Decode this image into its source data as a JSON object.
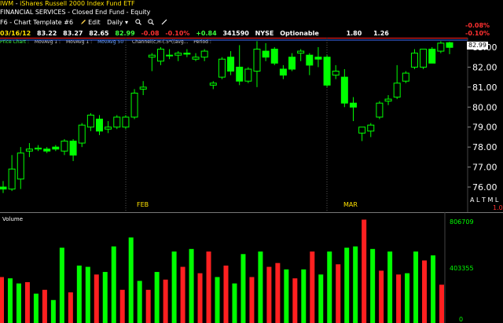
{
  "header": {
    "symbol": "IWM",
    "description": "iShares Russell 2000 Index Fund ETF",
    "subtitle": "FINANCIAL SERVICES - Closed End Fund - Equity",
    "template": "F6 - Chart Template #6",
    "edit": "Edit",
    "interval": "Daily"
  },
  "quote": {
    "date": "03/16/12",
    "open": "83.22",
    "high": "83.27",
    "low": "82.65",
    "close": "82.99",
    "change": "-0.08",
    "pct": "-0.10%",
    "chg2": "+0.84",
    "volume": "341590",
    "exchange": "NYSE",
    "optionable": "Optionable",
    "v1": "1.80",
    "v2": "1.26",
    "right_top": "-0.08%",
    "right_bottom": "-0.10%"
  },
  "studies": {
    "price_chart": "Price Chart :",
    "ma1": "MovAvg 1 :",
    "ma2": "MovAvg 1 :",
    "ma3": "MovAvg 50 :",
    "channel": "Channel(c,H-(.5*((avg...",
    "period": "Period :"
  },
  "price_axis": [
    "83.00",
    "82.00",
    "81.00",
    "80.00",
    "79.00",
    "78.00",
    "77.00",
    "76.00"
  ],
  "close_tag": "82.99",
  "altml": "A L T M L",
  "scale_factor": "1.0",
  "months": [
    "FEB",
    "MAR"
  ],
  "volume_label": "Volume",
  "volume_axis": [
    "806709",
    "403355",
    "0"
  ],
  "colors": {
    "up": "#00ff00",
    "down": "#ff2020",
    "background": "#000000"
  },
  "chart_data": {
    "type": "candlestick+bar",
    "price_ylim": [
      75.5,
      83.5
    ],
    "volume_ylim": [
      0,
      806709
    ],
    "candles": [
      {
        "o": 76.0,
        "h": 76.3,
        "l": 75.7,
        "c": 75.9
      },
      {
        "o": 75.9,
        "h": 77.6,
        "l": 75.8,
        "c": 76.9
      },
      {
        "o": 76.4,
        "h": 78.0,
        "l": 75.9,
        "c": 77.7
      },
      {
        "o": 77.8,
        "h": 78.2,
        "l": 77.5,
        "c": 77.9
      },
      {
        "o": 77.9,
        "h": 78.1,
        "l": 77.8,
        "c": 77.95
      },
      {
        "o": 77.9,
        "h": 78.0,
        "l": 77.7,
        "c": 77.8
      },
      {
        "o": 78.0,
        "h": 78.1,
        "l": 77.8,
        "c": 77.9
      },
      {
        "o": 77.8,
        "h": 78.4,
        "l": 77.6,
        "c": 78.3
      },
      {
        "o": 78.3,
        "h": 78.4,
        "l": 77.3,
        "c": 77.6
      },
      {
        "o": 78.2,
        "h": 79.2,
        "l": 78.0,
        "c": 79.1
      },
      {
        "o": 79.0,
        "h": 79.7,
        "l": 78.8,
        "c": 79.6
      },
      {
        "o": 79.4,
        "h": 79.6,
        "l": 78.6,
        "c": 78.8
      },
      {
        "o": 78.9,
        "h": 79.3,
        "l": 78.7,
        "c": 79.0
      },
      {
        "o": 79.0,
        "h": 79.6,
        "l": 78.9,
        "c": 79.5
      },
      {
        "o": 79.0,
        "h": 79.6,
        "l": 78.9,
        "c": 79.5
      },
      {
        "o": 79.5,
        "h": 80.9,
        "l": 79.4,
        "c": 80.7
      },
      {
        "o": 80.9,
        "h": 81.3,
        "l": 80.6,
        "c": 81.0
      },
      {
        "o": 82.5,
        "h": 82.7,
        "l": 81.8,
        "c": 82.6
      },
      {
        "o": 82.3,
        "h": 83.0,
        "l": 82.1,
        "c": 82.9
      },
      {
        "o": 82.6,
        "h": 82.9,
        "l": 82.4,
        "c": 82.6
      },
      {
        "o": 82.6,
        "h": 82.8,
        "l": 82.3,
        "c": 82.7
      },
      {
        "o": 82.7,
        "h": 82.9,
        "l": 82.5,
        "c": 82.65
      },
      {
        "o": 82.4,
        "h": 82.7,
        "l": 82.3,
        "c": 82.5
      },
      {
        "o": 82.5,
        "h": 82.9,
        "l": 82.3,
        "c": 82.8
      },
      {
        "o": 81.1,
        "h": 81.3,
        "l": 80.9,
        "c": 81.2
      },
      {
        "o": 81.5,
        "h": 82.5,
        "l": 81.4,
        "c": 82.4
      },
      {
        "o": 82.5,
        "h": 82.8,
        "l": 81.6,
        "c": 81.8
      },
      {
        "o": 82.0,
        "h": 83.1,
        "l": 81.1,
        "c": 81.3
      },
      {
        "o": 81.3,
        "h": 82.0,
        "l": 81.2,
        "c": 81.9
      },
      {
        "o": 81.8,
        "h": 83.3,
        "l": 81.0,
        "c": 82.9
      },
      {
        "o": 82.8,
        "h": 83.2,
        "l": 82.3,
        "c": 82.5
      },
      {
        "o": 82.9,
        "h": 83.0,
        "l": 82.1,
        "c": 82.2
      },
      {
        "o": 81.9,
        "h": 82.1,
        "l": 81.4,
        "c": 81.6
      },
      {
        "o": 82.5,
        "h": 82.7,
        "l": 81.8,
        "c": 81.9
      },
      {
        "o": 82.7,
        "h": 82.9,
        "l": 82.3,
        "c": 82.8
      },
      {
        "o": 82.6,
        "h": 82.7,
        "l": 81.6,
        "c": 82.1
      },
      {
        "o": 82.5,
        "h": 83.0,
        "l": 82.0,
        "c": 82.4
      },
      {
        "o": 82.5,
        "h": 82.6,
        "l": 81.0,
        "c": 81.1
      },
      {
        "o": 81.6,
        "h": 82.1,
        "l": 81.4,
        "c": 81.8
      },
      {
        "o": 81.5,
        "h": 81.9,
        "l": 80.0,
        "c": 80.2
      },
      {
        "o": 80.2,
        "h": 80.5,
        "l": 79.3,
        "c": 80.0
      },
      {
        "o": 78.7,
        "h": 79.0,
        "l": 78.3,
        "c": 79.0
      },
      {
        "o": 78.8,
        "h": 79.2,
        "l": 78.5,
        "c": 79.1
      },
      {
        "o": 79.5,
        "h": 80.3,
        "l": 79.4,
        "c": 80.2
      },
      {
        "o": 80.3,
        "h": 80.6,
        "l": 80.1,
        "c": 80.4
      },
      {
        "o": 80.5,
        "h": 82.1,
        "l": 80.4,
        "c": 81.2
      },
      {
        "o": 81.3,
        "h": 81.8,
        "l": 81.2,
        "c": 81.7
      },
      {
        "o": 82.0,
        "h": 82.9,
        "l": 81.9,
        "c": 82.7
      },
      {
        "o": 82.0,
        "h": 82.9,
        "l": 81.9,
        "c": 82.9
      },
      {
        "o": 82.9,
        "h": 83.0,
        "l": 82.6,
        "c": 82.2
      },
      {
        "o": 82.8,
        "h": 83.3,
        "l": 82.7,
        "c": 83.2
      },
      {
        "o": 83.22,
        "h": 83.27,
        "l": 82.65,
        "c": 82.99
      }
    ],
    "volumes": [
      {
        "v": 360000,
        "up": false
      },
      {
        "v": 350000,
        "up": true
      },
      {
        "v": 310000,
        "up": true
      },
      {
        "v": 320000,
        "up": false
      },
      {
        "v": 230000,
        "up": true
      },
      {
        "v": 260000,
        "up": false
      },
      {
        "v": 180000,
        "up": true
      },
      {
        "v": 590000,
        "up": true
      },
      {
        "v": 240000,
        "up": false
      },
      {
        "v": 450000,
        "up": true
      },
      {
        "v": 440000,
        "up": true
      },
      {
        "v": 380000,
        "up": false
      },
      {
        "v": 400000,
        "up": true
      },
      {
        "v": 600000,
        "up": true
      },
      {
        "v": 260000,
        "up": false
      },
      {
        "v": 670000,
        "up": true
      },
      {
        "v": 330000,
        "up": true
      },
      {
        "v": 260000,
        "up": false
      },
      {
        "v": 400000,
        "up": true
      },
      {
        "v": 340000,
        "up": false
      },
      {
        "v": 560000,
        "up": true
      },
      {
        "v": 440000,
        "up": false
      },
      {
        "v": 580000,
        "up": true
      },
      {
        "v": 390000,
        "up": false
      },
      {
        "v": 560000,
        "up": false
      },
      {
        "v": 360000,
        "up": true
      },
      {
        "v": 450000,
        "up": false
      },
      {
        "v": 310000,
        "up": true
      },
      {
        "v": 540000,
        "up": true
      },
      {
        "v": 360000,
        "up": false
      },
      {
        "v": 560000,
        "up": true
      },
      {
        "v": 440000,
        "up": false
      },
      {
        "v": 470000,
        "up": false
      },
      {
        "v": 420000,
        "up": true
      },
      {
        "v": 350000,
        "up": false
      },
      {
        "v": 420000,
        "up": true
      },
      {
        "v": 560000,
        "up": false
      },
      {
        "v": 380000,
        "up": true
      },
      {
        "v": 560000,
        "up": true
      },
      {
        "v": 460000,
        "up": false
      },
      {
        "v": 590000,
        "up": true
      },
      {
        "v": 600000,
        "up": true
      },
      {
        "v": 810000,
        "up": false
      },
      {
        "v": 580000,
        "up": true
      },
      {
        "v": 410000,
        "up": false
      },
      {
        "v": 560000,
        "up": true
      },
      {
        "v": 380000,
        "up": false
      },
      {
        "v": 390000,
        "up": true
      },
      {
        "v": 560000,
        "up": true
      },
      {
        "v": 490000,
        "up": false
      },
      {
        "v": 530000,
        "up": true
      },
      {
        "v": 300000,
        "up": false
      }
    ]
  }
}
